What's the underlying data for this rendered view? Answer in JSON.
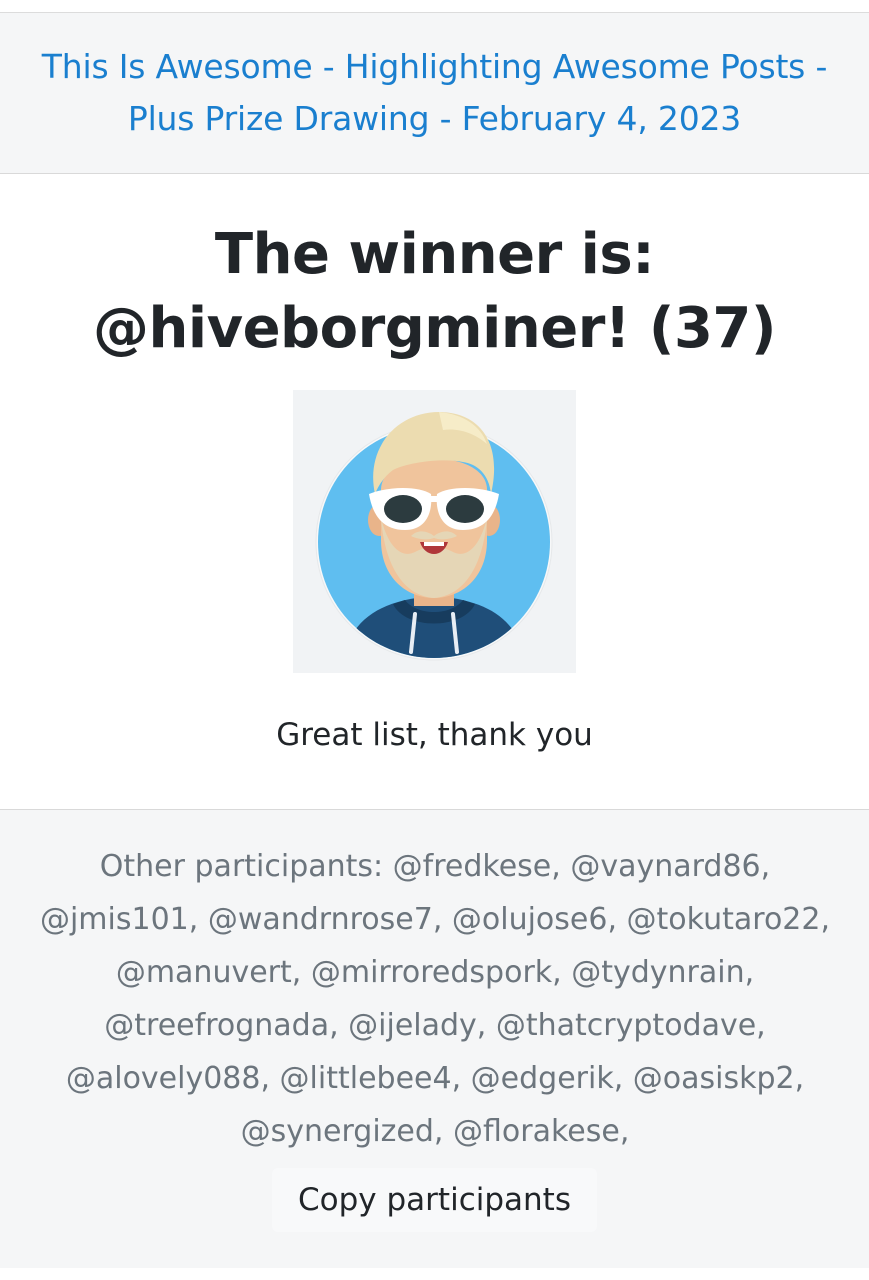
{
  "header": {
    "post_title": "This Is Awesome - Highlighting Awesome Posts - Plus Prize Drawing - February 4, 2023"
  },
  "winner": {
    "title_line1": "The winner is:",
    "title_line2": "@hiveborgminer! (37)",
    "comment": "Great list, thank you",
    "avatar_icon": "avatar-bearded-man-sunglasses"
  },
  "footer": {
    "participants_text": "Other participants: @fredkese, @vaynard86, @jmis101, @wandrnrose7, @olujose6, @tokutaro22, @manuvert, @mirroredspork, @tydynrain, @treefrognada, @ijelady, @thatcryptodave, @alovely088, @littlebee4, @edgerik, @oasiskp2, @synergized, @florakese,",
    "copy_button_label": "Copy participants"
  },
  "colors": {
    "link": "#1a7fcf",
    "header_bg": "#f5f6f7",
    "muted_text": "#6c757d"
  }
}
